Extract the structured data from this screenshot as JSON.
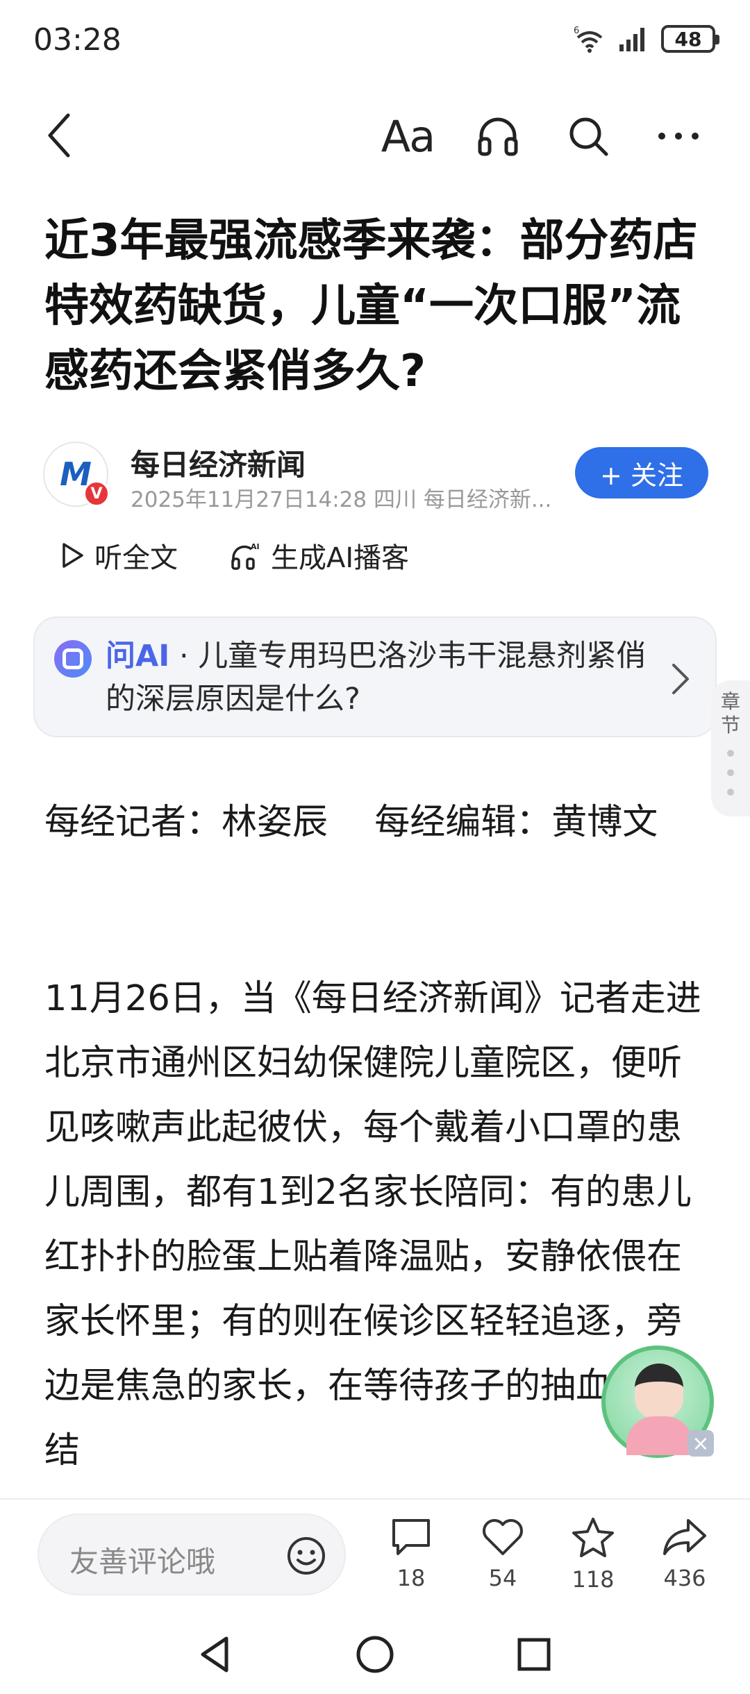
{
  "status_bar": {
    "time": "03:28",
    "battery": "48",
    "network": "6"
  },
  "nav": {
    "font_label": "Aa"
  },
  "article": {
    "title": "近3年最强流感季来袭：部分药店特效药缺货，儿童“一次口服”流感药还会紧俏多久?",
    "author_name": "每日经济新闻",
    "author_meta": "2025年11月27日14:28 四川 每日经济新...",
    "avatar_logo": "M",
    "verified_badge": "V",
    "follow_label": "+ 关注",
    "listen_full": "听全文",
    "ai_podcast": "生成AI播客",
    "ai_card": {
      "label": "问AI",
      "separator": " · ",
      "question": "儿童专用玛巴洛沙韦干混悬剂紧俏的深层原因是什么?"
    },
    "chapter_label": "章节",
    "byline": "每经记者：林姿辰　 每经编辑：黄博文",
    "paragraph": "11月26日，当《每日经济新闻》记者走进北京市通州区妇幼保健院儿童院区，便听见咳嗽声此起彼伏，每个戴着小口罩的患儿周围，都有1到2名家长陪同：有的患儿红扑扑的脸蛋上贴着降温贴，安静依偎在家长怀里；有的则在候诊区轻轻追逐，旁边是焦急的家长，在等待孩子的抽血化验结"
  },
  "bottom_bar": {
    "comment_placeholder": "友善评论哦",
    "comments": "18",
    "likes": "54",
    "favorites": "118",
    "shares": "436"
  },
  "colors": {
    "accent": "#2f6fe8",
    "ai_label": "#4a66e8",
    "badge_red": "#e8343b"
  }
}
